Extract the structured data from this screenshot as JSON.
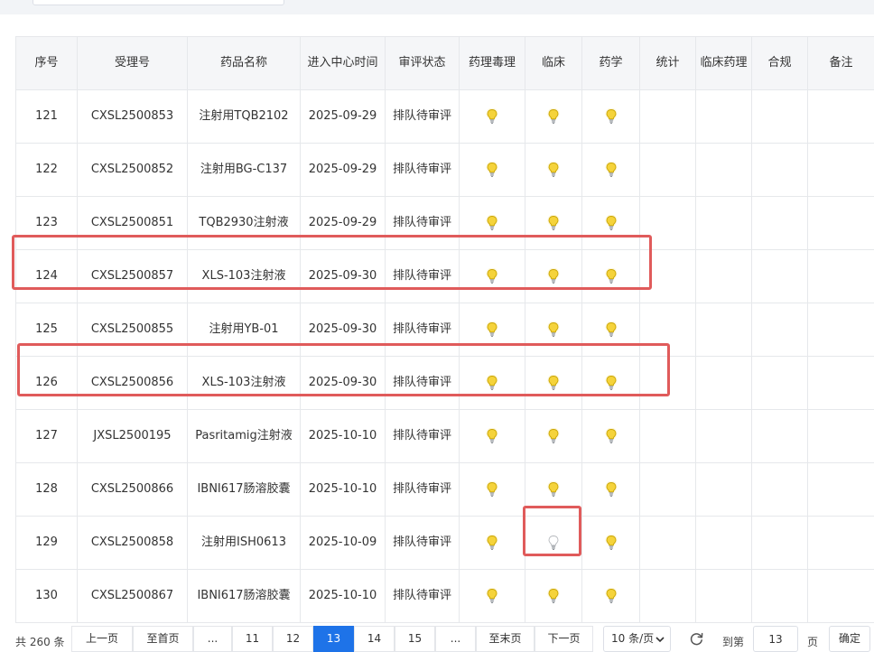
{
  "table": {
    "headers": [
      "序号",
      "受理号",
      "药品名称",
      "进入中心时间",
      "审评状态",
      "药理毒理",
      "临床",
      "药学",
      "统计",
      "临床药理",
      "合规",
      "备注"
    ],
    "rows": [
      {
        "no": "121",
        "code": "CXSL2500853",
        "name": "注射用TQB2102",
        "date": "2025-09-29",
        "status": "排队待审评",
        "pharm_tox": "lit",
        "clinical": "lit",
        "cmc": "lit"
      },
      {
        "no": "122",
        "code": "CXSL2500852",
        "name": "注射用BG-C137",
        "date": "2025-09-29",
        "status": "排队待审评",
        "pharm_tox": "lit",
        "clinical": "lit",
        "cmc": "lit"
      },
      {
        "no": "123",
        "code": "CXSL2500851",
        "name": "TQB2930注射液",
        "date": "2025-09-29",
        "status": "排队待审评",
        "pharm_tox": "lit",
        "clinical": "lit",
        "cmc": "lit"
      },
      {
        "no": "124",
        "code": "CXSL2500857",
        "name": "XLS-103注射液",
        "date": "2025-09-30",
        "status": "排队待审评",
        "pharm_tox": "lit",
        "clinical": "lit",
        "cmc": "lit"
      },
      {
        "no": "125",
        "code": "CXSL2500855",
        "name": "注射用YB-01",
        "date": "2025-09-30",
        "status": "排队待审评",
        "pharm_tox": "lit",
        "clinical": "lit",
        "cmc": "lit"
      },
      {
        "no": "126",
        "code": "CXSL2500856",
        "name": "XLS-103注射液",
        "date": "2025-09-30",
        "status": "排队待审评",
        "pharm_tox": "lit",
        "clinical": "lit",
        "cmc": "lit"
      },
      {
        "no": "127",
        "code": "JXSL2500195",
        "name": "Pasritamig注射液",
        "date": "2025-10-10",
        "status": "排队待审评",
        "pharm_tox": "lit",
        "clinical": "lit",
        "cmc": "lit"
      },
      {
        "no": "128",
        "code": "CXSL2500866",
        "name": "IBNI617肠溶胶囊",
        "date": "2025-10-10",
        "status": "排队待审评",
        "pharm_tox": "lit",
        "clinical": "lit",
        "cmc": "lit"
      },
      {
        "no": "129",
        "code": "CXSL2500858",
        "name": "注射用ISH0613",
        "date": "2025-10-09",
        "status": "排队待审评",
        "pharm_tox": "lit",
        "clinical": "unlit",
        "cmc": "lit"
      },
      {
        "no": "130",
        "code": "CXSL2500867",
        "name": "IBNI617肠溶胶囊",
        "date": "2025-10-10",
        "status": "排队待审评",
        "pharm_tox": "lit",
        "clinical": "lit",
        "cmc": "lit"
      }
    ]
  },
  "pagination": {
    "total": "共 260 条",
    "prev": "上一页",
    "first": "至首页",
    "ellipsis_left": "...",
    "pages": [
      "11",
      "12",
      "13",
      "14",
      "15"
    ],
    "current": "13",
    "ellipsis_right": "...",
    "last": "至末页",
    "next": "下一页",
    "page_size": "10 条/页",
    "goto_label": "到第",
    "goto_value": "13",
    "page_unit": "页",
    "confirm": "确定"
  },
  "colors": {
    "highlight": "#e05b5b",
    "active_page": "#1e73e8",
    "bulb_lit": "#f5d33b",
    "bulb_unlit": "#d9dcdf"
  },
  "icons": {
    "lit": "lightbulb-on-icon",
    "unlit": "lightbulb-off-icon",
    "refresh": "refresh-icon",
    "chevron": "chevron-down-icon"
  }
}
